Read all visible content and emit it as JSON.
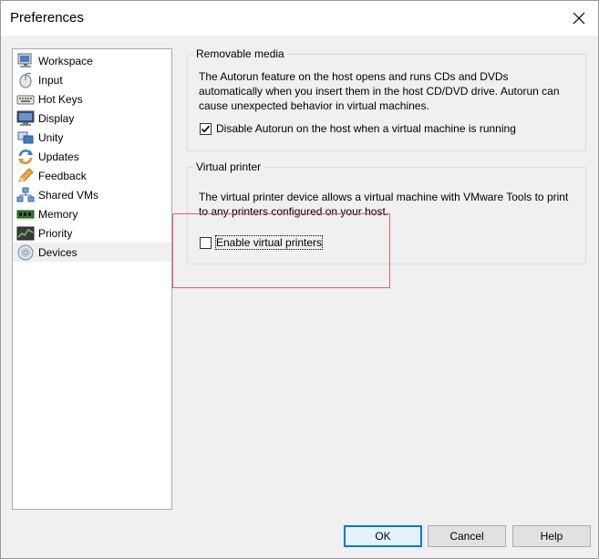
{
  "window": {
    "title": "Preferences"
  },
  "sidebar": {
    "items": [
      {
        "label": "Workspace",
        "icon": "workspace-icon"
      },
      {
        "label": "Input",
        "icon": "mouse-icon"
      },
      {
        "label": "Hot Keys",
        "icon": "keyboard-icon"
      },
      {
        "label": "Display",
        "icon": "monitor-icon"
      },
      {
        "label": "Unity",
        "icon": "unity-icon"
      },
      {
        "label": "Updates",
        "icon": "updates-icon"
      },
      {
        "label": "Feedback",
        "icon": "feedback-icon"
      },
      {
        "label": "Shared VMs",
        "icon": "network-icon"
      },
      {
        "label": "Memory",
        "icon": "memory-icon"
      },
      {
        "label": "Priority",
        "icon": "priority-icon"
      },
      {
        "label": "Devices",
        "icon": "cd-icon",
        "selected": true
      }
    ]
  },
  "removable_media": {
    "title": "Removable media",
    "description": "The Autorun feature on the host opens and runs CDs and DVDs automatically when you insert them in the host CD/DVD drive. Autorun can cause unexpected behavior in virtual machines.",
    "checkbox_label": "Disable Autorun on the host when a virtual machine is running",
    "checked": true
  },
  "virtual_printer": {
    "title": "Virtual printer",
    "description": "The virtual printer device allows a virtual machine with VMware Tools to print to any printers configured on your host.",
    "checkbox_label": "Enable virtual printers",
    "checked": false
  },
  "buttons": {
    "ok": "OK",
    "cancel": "Cancel",
    "help": "Help"
  },
  "colors": {
    "accent": "#0078d7",
    "highlight": "#e06060"
  }
}
